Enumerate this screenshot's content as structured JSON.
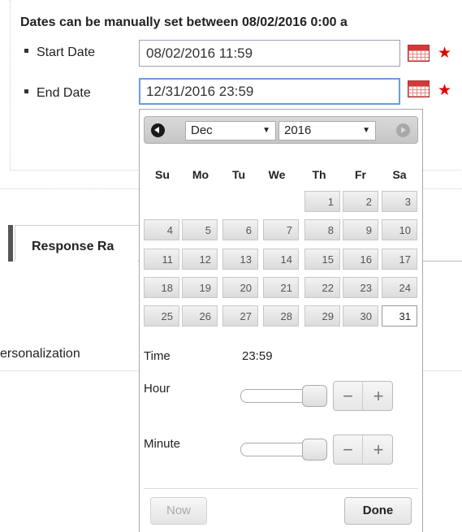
{
  "note": "Dates can be manually set between 08/02/2016 0:00 a",
  "start_date": {
    "label": "Start Date",
    "value": "08/02/2016 11:59"
  },
  "end_date": {
    "label": "End Date",
    "value": "12/31/2016 23:59"
  },
  "required_mark": "★",
  "background": {
    "tab_label": "Response Ra",
    "personalization": "ersonalization"
  },
  "datepicker": {
    "month": "Dec",
    "year": "2016",
    "weekdays": [
      "Su",
      "Mo",
      "Tu",
      "We",
      "Th",
      "Fr",
      "Sa"
    ],
    "weeks": [
      [
        "",
        "",
        "",
        "",
        "1",
        "2",
        "3"
      ],
      [
        "4",
        "5",
        "6",
        "7",
        "8",
        "9",
        "10"
      ],
      [
        "11",
        "12",
        "13",
        "14",
        "15",
        "16",
        "17"
      ],
      [
        "18",
        "19",
        "20",
        "21",
        "22",
        "23",
        "24"
      ],
      [
        "25",
        "26",
        "27",
        "28",
        "29",
        "30",
        "31"
      ]
    ],
    "selected_day": "31",
    "time_label": "Time",
    "time_value": "23:59",
    "hour_label": "Hour",
    "hour_value": 23,
    "minute_label": "Minute",
    "minute_value": 59,
    "minus_symbol": "−",
    "plus_symbol": "+",
    "now_label": "Now",
    "done_label": "Done"
  }
}
